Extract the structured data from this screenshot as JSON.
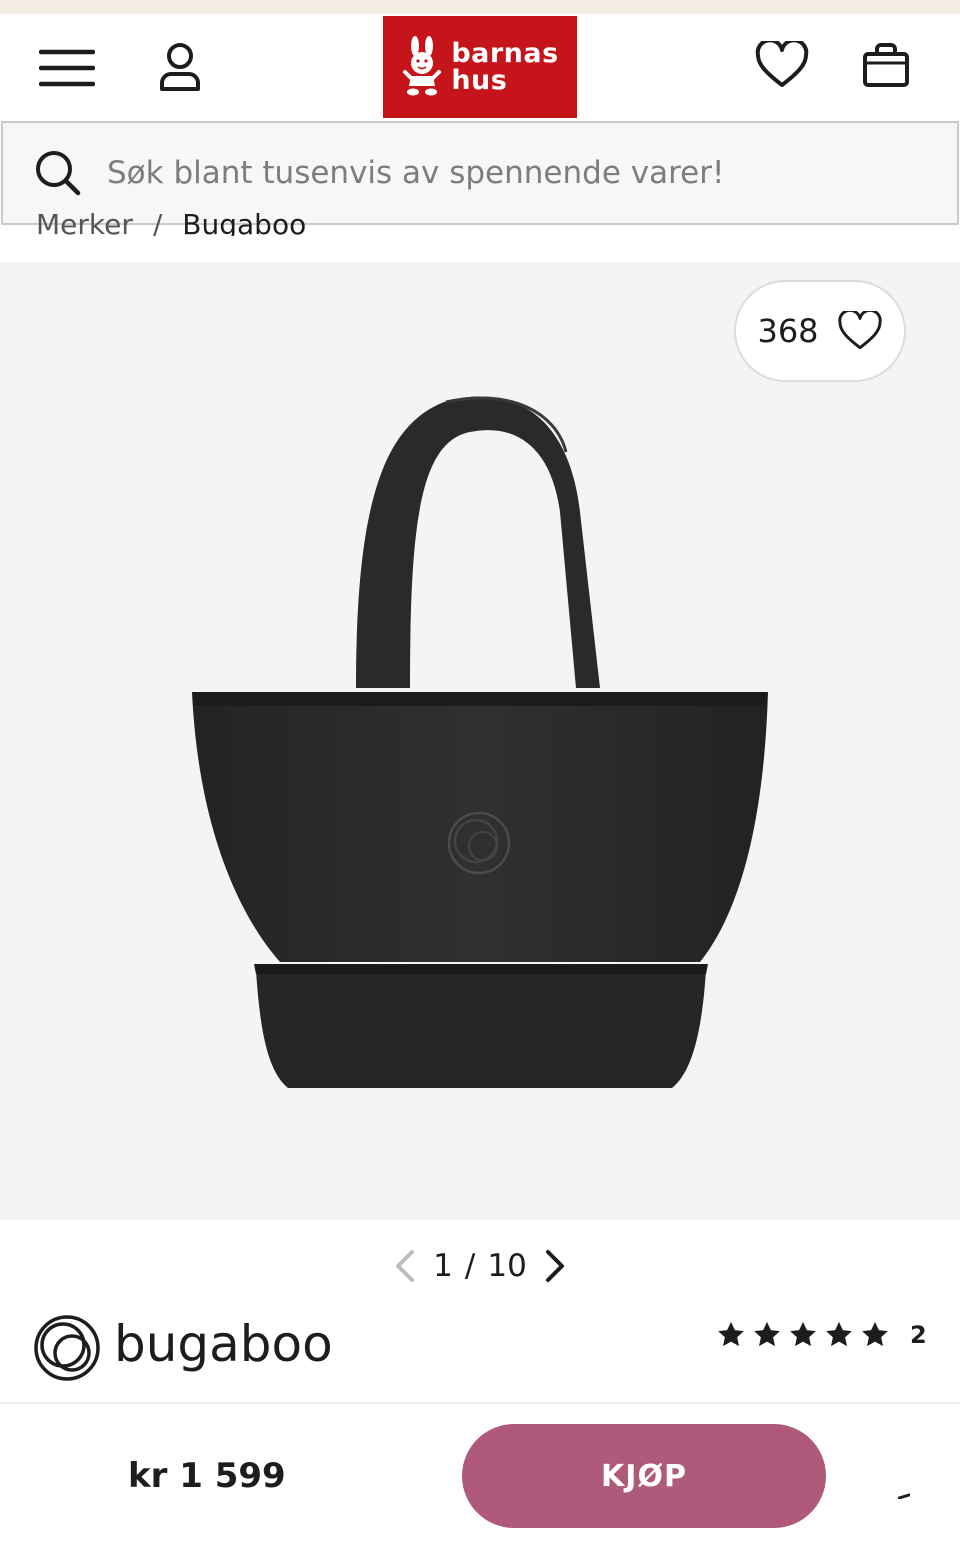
{
  "header": {
    "logo_text_line1": "barnas",
    "logo_text_line2": "hus",
    "brand_color": "#c6141b",
    "icons": [
      "menu-icon",
      "user-icon",
      "heart-icon",
      "shopping-bag-icon"
    ]
  },
  "search": {
    "placeholder": "Søk blant tusenvis av spennende varer!"
  },
  "breadcrumb": {
    "items": [
      "Merker",
      "Bugaboo"
    ],
    "separator": "/"
  },
  "gallery": {
    "favorite_count": "368",
    "current": "1",
    "separator": "/",
    "total": "10",
    "background": "#f4f4f4"
  },
  "product": {
    "brand": "bugaboo",
    "rating_stars": 5,
    "review_count": "2",
    "price": "kr 1 599",
    "buy_label": "KJØP",
    "buy_color": "#b05a7b"
  }
}
